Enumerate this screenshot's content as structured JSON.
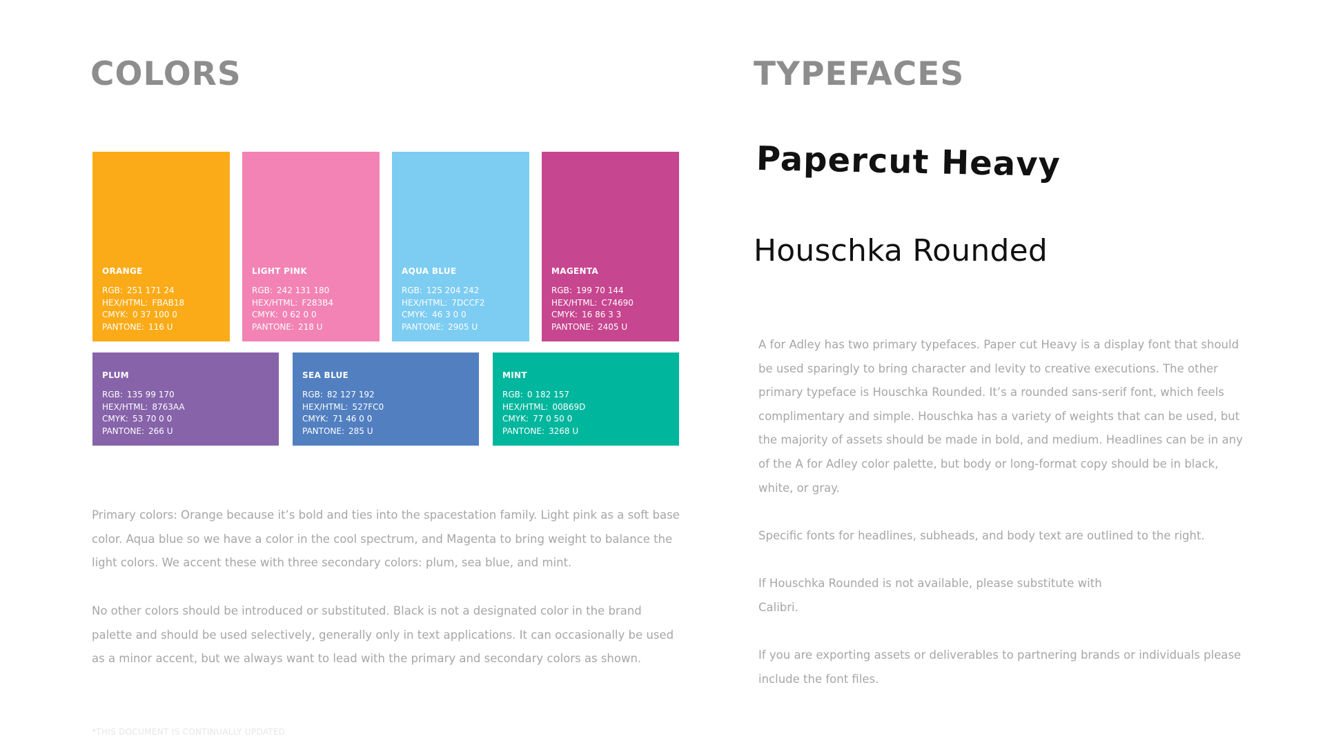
{
  "colors_section": {
    "title": "COLORS",
    "swatches": [
      {
        "name": "ORANGE",
        "hex": "#FBAB18",
        "rgb": "251 171 24",
        "hex_html": "FBAB18",
        "cmyk": "0 37 100 0",
        "pantone": "116 U"
      },
      {
        "name": "LIGHT PINK",
        "hex": "#F283B4",
        "rgb": "242 131 180",
        "hex_html": "F283B4",
        "cmyk": "0 62 0 0",
        "pantone": "218 U"
      },
      {
        "name": "AQUA BLUE",
        "hex": "#7DCCF2",
        "rgb": "125 204 242",
        "hex_html": "7DCCF2",
        "cmyk": "46 3 0 0",
        "pantone": "2905 U"
      },
      {
        "name": "MAGENTA",
        "hex": "#C74690",
        "rgb": "199 70 144",
        "hex_html": "C74690",
        "cmyk": "16 86 3 3",
        "pantone": "2405 U"
      },
      {
        "name": "PLUM",
        "hex": "#8763AA",
        "rgb": "135 99 170",
        "hex_html": "8763AA",
        "cmyk": "53 70 0 0",
        "pantone": "266 U"
      },
      {
        "name": "SEA BLUE",
        "hex": "#527FC0",
        "rgb": "82 127 192",
        "hex_html": "527FC0",
        "cmyk": "71 46 0 0",
        "pantone": "285 U"
      },
      {
        "name": "MINT",
        "hex": "#00B69D",
        "rgb": "0 182 157",
        "hex_html": "00B69D",
        "cmyk": "77 0 50 0",
        "pantone": "3268 U"
      }
    ],
    "labels": {
      "rgb": "RGB:",
      "hex_html": "HEX/HTML:",
      "cmyk": "CMYK:",
      "pantone": "PANTONE:"
    },
    "paragraph_1": "Primary colors: Orange because it’s bold and ties into the spacestation family. Light pink as a soft base color. Aqua blue so we have a color in the cool spectrum, and Magenta to bring weight to balance the light colors. We accent these with three secondary colors: plum, sea blue, and mint.",
    "paragraph_2": "No other colors should be introduced or substituted. Black is not a designated color in the brand palette and should be used selectively, generally only in text applications. It can occasionally be used as a minor accent, but we always want to lead with the primary and secondary colors as shown.",
    "footnote": "*THIS DOCUMENT IS CONTINUALLY UPDATED"
  },
  "typefaces_section": {
    "title": "TYPEFACES",
    "font_1": "Papercut Heavy",
    "font_2": "Houschka Rounded",
    "paragraph_1": "A for Adley has two primary typefaces. Paper cut Heavy is a display font that should be used sparingly to bring character and levity to creative executions. The other primary typeface is Houschka Rounded. It’s a rounded sans-serif font, which feels complimentary and simple. Houschka has a variety of weights that can be used, but the majority of assets should be made in bold, and medium. Headlines can be in any of the A for Adley color palette, but body or long-format copy should be in black, white, or gray.",
    "paragraph_2": "Specific fonts for headlines, subheads, and body text are outlined to the right.",
    "paragraph_3a": "If Houschka Rounded is not available, please substitute with",
    "paragraph_3b": "Calibri.",
    "paragraph_4": "If you are exporting assets or deliverables to partnering brands or individuals please include the font files."
  }
}
